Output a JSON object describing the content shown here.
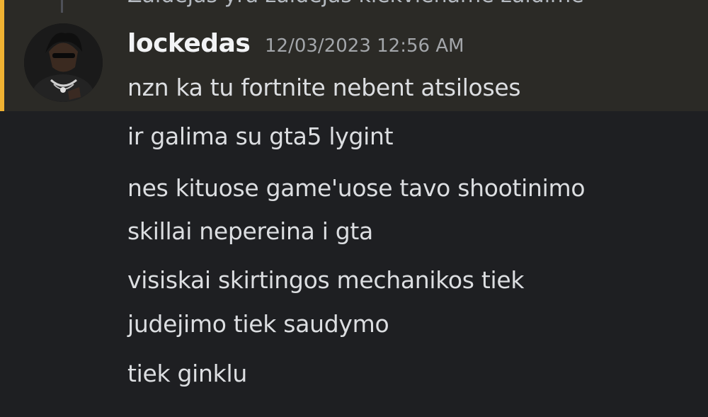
{
  "reply": {
    "preview_text": "Zaidejas yra zaidejas kiekviename zaidime"
  },
  "message": {
    "username": "lockedas",
    "timestamp": "12/03/2023 12:56 AM",
    "lines": [
      "nzn ka tu fortnite nebent atsiloses",
      "ir galima su gta5 lygint",
      "nes kituose game'uose tavo shootinimo",
      "skillai nepereina i gta",
      "visiskai skirtingos mechanikos tiek",
      "judejimo tiek saudymo",
      "tiek ginklu"
    ]
  },
  "colors": {
    "background": "#1e1f22",
    "highlight": "#2b2a26",
    "mention_accent": "#f0b232",
    "username": "#f2f3f5",
    "text": "#dcdee1",
    "timestamp": "#a3a6aa"
  }
}
